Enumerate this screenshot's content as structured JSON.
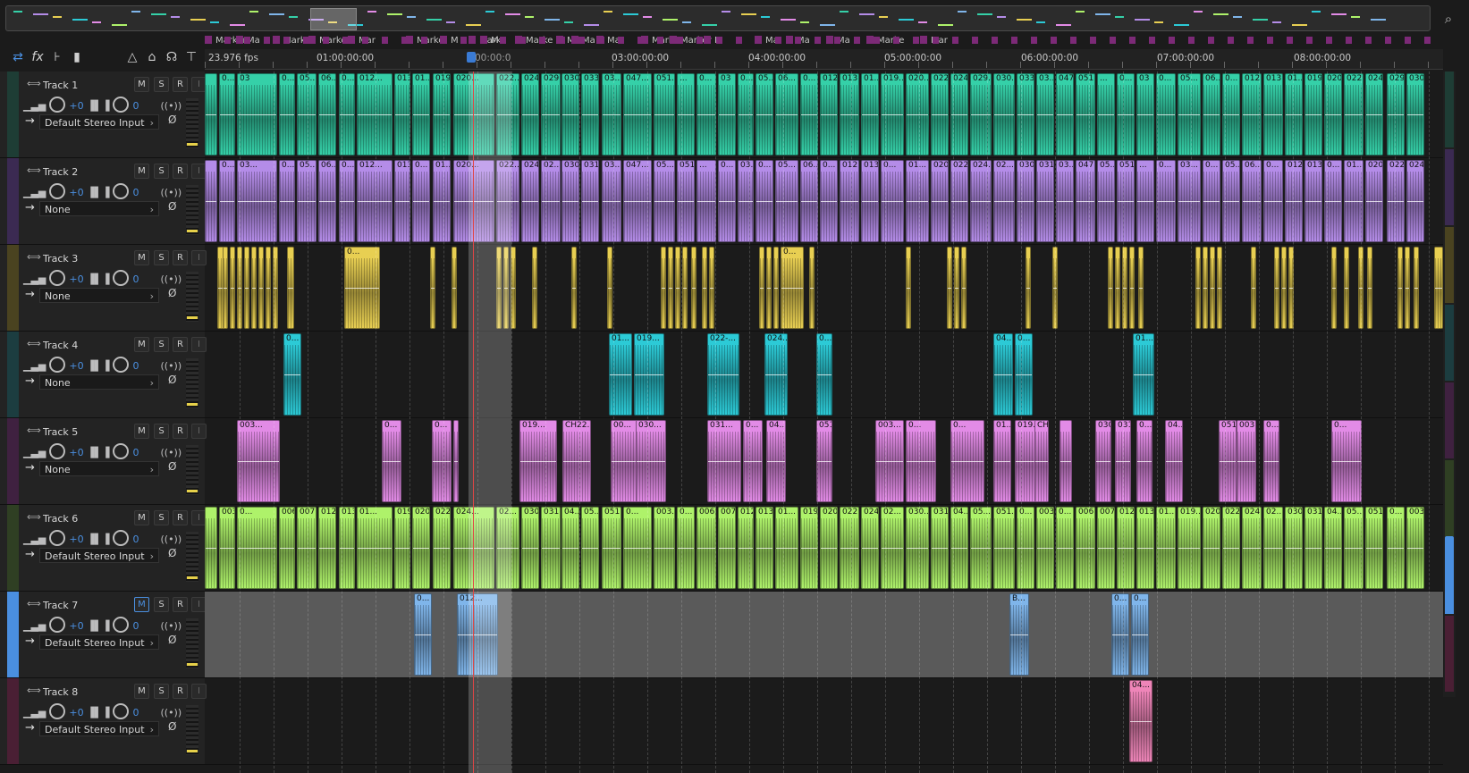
{
  "overview": {
    "label": "session-overview"
  },
  "toolbar": {
    "icons": [
      "swap-icon",
      "fx-icon",
      "send-icon",
      "bars-icon",
      "tuner-icon",
      "lock-icon",
      "headphones-icon",
      "pin-icon"
    ]
  },
  "ruler": {
    "framerate": "23.976 fps",
    "ticks": [
      "01:00:00:00",
      "03:00:00:00",
      "04:00:00:00",
      "05:00:00:00",
      "06:00:00:00",
      "07:00:00:00",
      "08:00:00:00"
    ],
    "playhead_label": "00:00:0"
  },
  "markers": [
    "Marker",
    "Ma",
    "Marke",
    "Marker",
    "Mar",
    "Marke",
    "M",
    "Marke",
    "M",
    "Marke",
    "M",
    "Ma",
    "Ma",
    "Marke",
    "Marker",
    "M",
    "Ma",
    "Ma",
    "Ma",
    "Marke",
    "Mar"
  ],
  "tracks": [
    {
      "name": "Track 1",
      "input": "Default Stereo Input",
      "volume": "+0",
      "pan": "0",
      "color": "#35d0a8",
      "stripe": "#1e3d35",
      "clips": [
        "...",
        "0...",
        "03",
        "0...",
        "05...",
        "06...",
        "0...",
        "012...",
        "013...",
        "01...",
        "019...",
        "020...",
        "022...",
        "024...",
        "029...",
        "030...",
        "033...",
        "03...",
        "047...",
        "051..."
      ]
    },
    {
      "name": "Track 2",
      "input": "None",
      "volume": "+0",
      "pan": "0",
      "color": "#b48ce8",
      "stripe": "#3b2a52",
      "clips": [
        "...",
        "0...",
        "03...",
        "0...",
        "05...",
        "06...",
        "0...",
        "012...",
        "013...",
        "0...",
        "01...",
        "020...",
        "022...",
        "024...",
        "02...",
        "030...",
        "031...",
        "03...",
        "047...",
        "05...",
        "051..."
      ]
    },
    {
      "name": "Track 3",
      "input": "None",
      "volume": "+0",
      "pan": "0",
      "color": "#e8cf52",
      "stripe": "#4a4320",
      "clips": [
        "0..."
      ]
    },
    {
      "name": "Track 4",
      "input": "None",
      "volume": "+0",
      "pan": "0",
      "color": "#2ccad6",
      "stripe": "#1c3d40",
      "clips": [
        "0...",
        "01...",
        "019...",
        "022-...",
        "024...",
        "0...",
        "04..."
      ]
    },
    {
      "name": "Track 5",
      "input": "None",
      "volume": "+0",
      "pan": "0",
      "color": "#e28be6",
      "stripe": "#3f2140",
      "clips": [
        "003...",
        "0...",
        "0...",
        "01...",
        "019...",
        "CH22...",
        "00...",
        "030...",
        "031...",
        "0...",
        "04...",
        "051..."
      ]
    },
    {
      "name": "Track 6",
      "input": "Default Stereo Input",
      "volume": "+0",
      "pan": "0",
      "color": "#aef26a",
      "stripe": "#2f3f23",
      "clips": [
        "0...",
        "003...",
        "0...",
        "006...",
        "007...",
        "012...",
        "013...",
        "01...",
        "019...",
        "020...",
        "022...",
        "024...",
        "02...",
        "030...",
        "031...",
        "04...",
        "05...",
        "051..."
      ]
    },
    {
      "name": "Track 7",
      "input": "Default Stereo Input",
      "volume": "+0",
      "pan": "0",
      "color": "#7fb5ea",
      "stripe": "#4a8fe0",
      "clips": [
        "0...",
        "012...",
        "B...",
        "0..."
      ]
    },
    {
      "name": "Track 8",
      "input": "Default Stereo Input",
      "volume": "+0",
      "pan": "0",
      "color": "#ee85b8",
      "stripe": "#4a1f34",
      "clips": [
        "04..."
      ]
    }
  ],
  "buttons": {
    "mute": "M",
    "solo": "S",
    "record": "R",
    "input": "I"
  }
}
